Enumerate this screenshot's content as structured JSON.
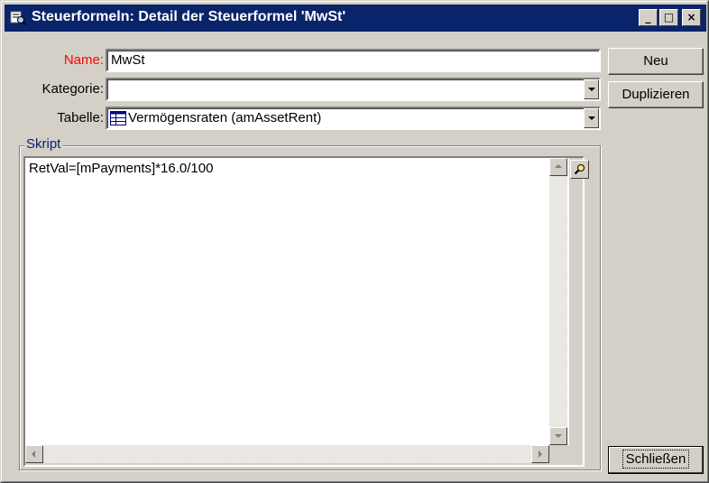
{
  "window": {
    "title": "Steuerformeln: Detail der Steuerformel 'MwSt'",
    "minimize_glyph": "_",
    "maximize_glyph": "□",
    "close_glyph": "×"
  },
  "form": {
    "name_label": "Name:",
    "name_value": "MwSt",
    "kategorie_label": "Kategorie:",
    "kategorie_value": "",
    "tabelle_label": "Tabelle:",
    "tabelle_value": "Vermögensraten (amAssetRent)"
  },
  "script": {
    "group_label": "Skript",
    "code": "RetVal=[mPayments]*16.0/100"
  },
  "buttons": {
    "neu": "Neu",
    "duplizieren": "Duplizieren",
    "schliessen": "Schließen"
  },
  "colors": {
    "titlebar": "#0a246a",
    "required_label": "#ff0000",
    "face": "#d4d0c8"
  },
  "icons": {
    "window": "form-magnifier-icon",
    "table": "table-icon",
    "zoom": "magnifier-icon"
  }
}
